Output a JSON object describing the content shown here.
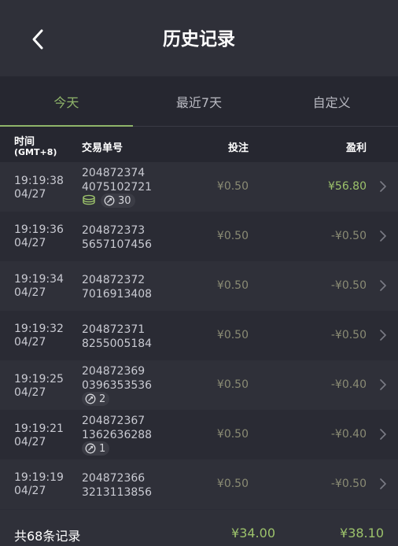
{
  "header": {
    "title": "历史记录"
  },
  "tabs": [
    {
      "label": "今天",
      "active": true
    },
    {
      "label": "最近7天",
      "active": false
    },
    {
      "label": "自定义",
      "active": false
    }
  ],
  "columns": {
    "time": "时间",
    "timezone": "(GMT+8)",
    "order": "交易单号",
    "bet": "投注",
    "profit": "盈利"
  },
  "rows": [
    {
      "time": "19:19:38",
      "date": "04/27",
      "order_a": "204872374",
      "order_b": "4075102721",
      "bet": "¥0.50",
      "profit": "¥56.80",
      "coins_icon": true,
      "badge": "30"
    },
    {
      "time": "19:19:36",
      "date": "04/27",
      "order_a": "204872373",
      "order_b": "5657107456",
      "bet": "¥0.50",
      "profit": "-¥0.50"
    },
    {
      "time": "19:19:34",
      "date": "04/27",
      "order_a": "204872372",
      "order_b": "7016913408",
      "bet": "¥0.50",
      "profit": "-¥0.50"
    },
    {
      "time": "19:19:32",
      "date": "04/27",
      "order_a": "204872371",
      "order_b": "8255005184",
      "bet": "¥0.50",
      "profit": "-¥0.50"
    },
    {
      "time": "19:19:25",
      "date": "04/27",
      "order_a": "204872369",
      "order_b": "0396353536",
      "bet": "¥0.50",
      "profit": "-¥0.40",
      "badge": "2"
    },
    {
      "time": "19:19:21",
      "date": "04/27",
      "order_a": "204872367",
      "order_b": "1362636288",
      "bet": "¥0.50",
      "profit": "-¥0.40",
      "badge": "1"
    },
    {
      "time": "19:19:19",
      "date": "04/27",
      "order_a": "204872366",
      "order_b": "3213113856",
      "bet": "¥0.50",
      "profit": "-¥0.50"
    }
  ],
  "footer": {
    "label": "共68条记录",
    "total_bet": "¥34.00",
    "total_profit": "¥38.10"
  },
  "colors": {
    "accent": "#8fb56a",
    "positive": "#9cc26b",
    "muted": "#8a8b74"
  }
}
